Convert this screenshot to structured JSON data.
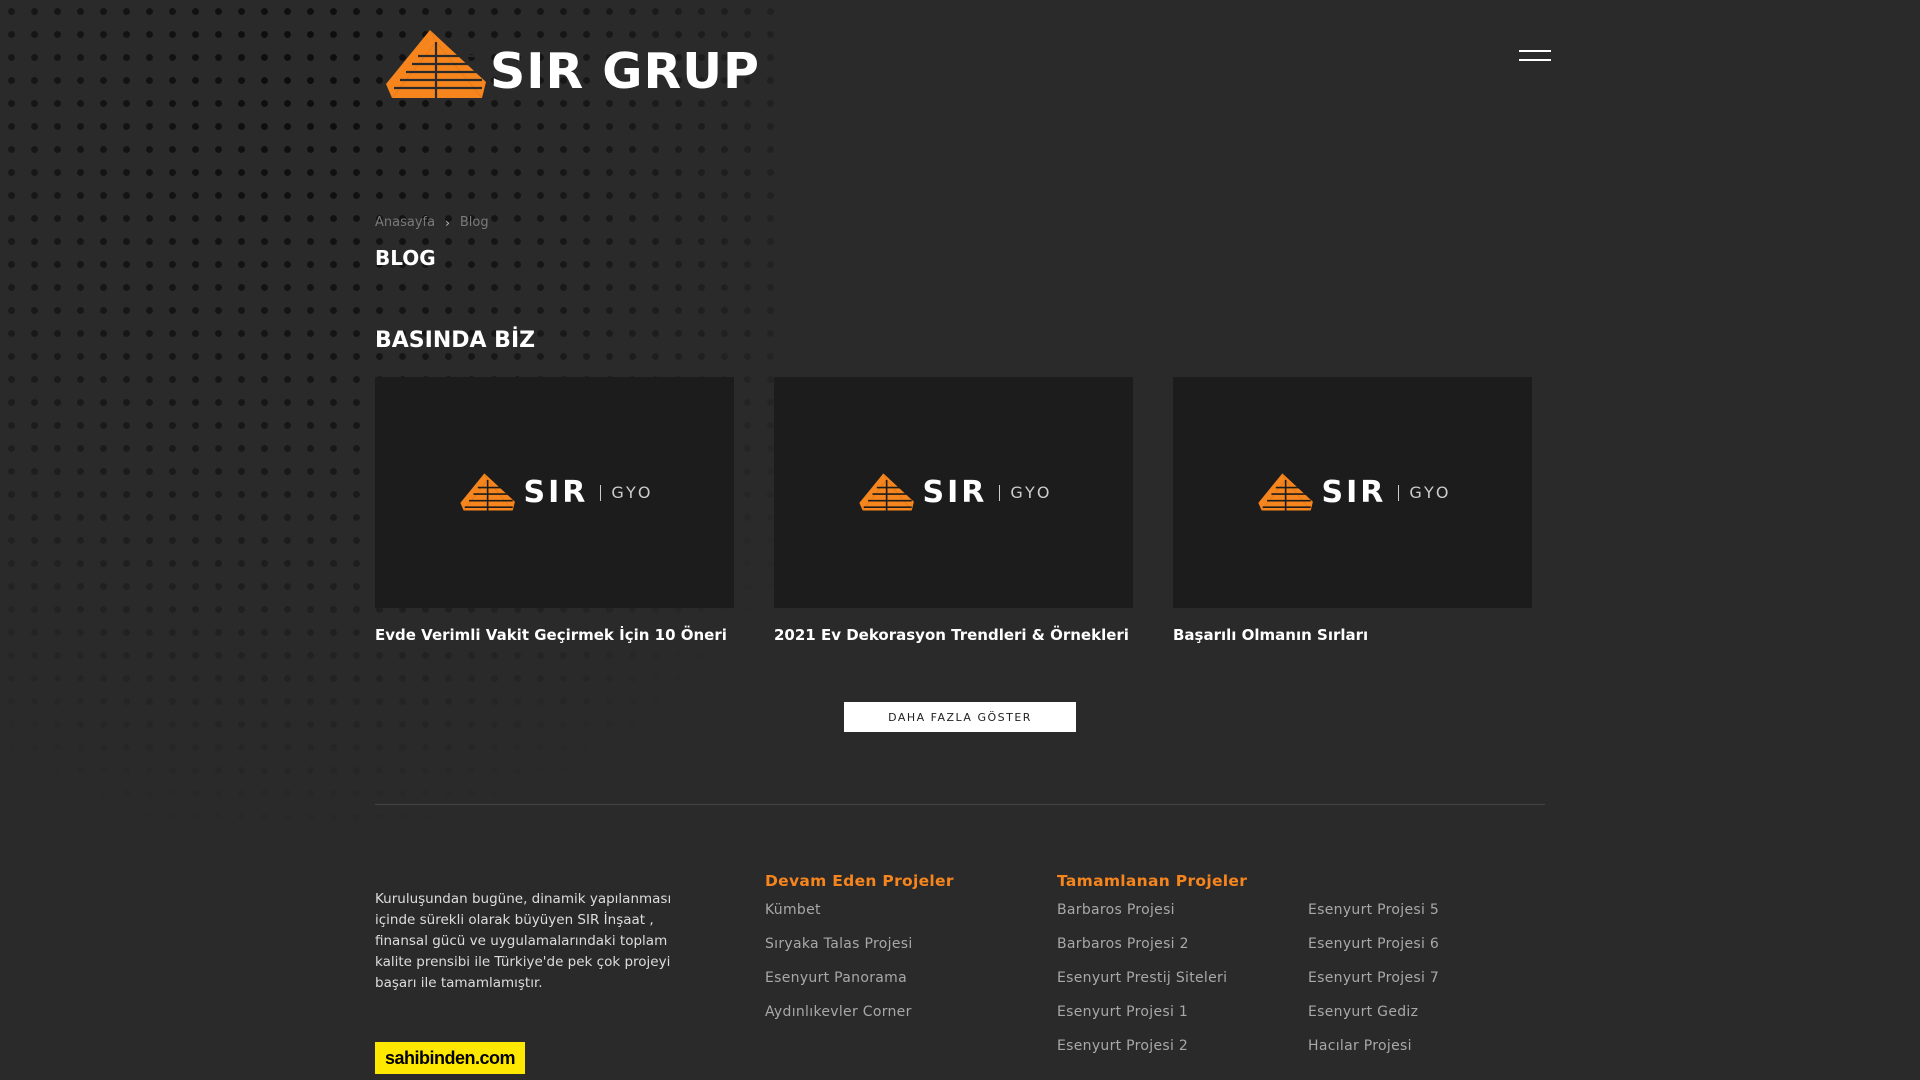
{
  "header": {
    "logo_text": "SIR GRUP",
    "brand_color": "#f7851d"
  },
  "breadcrumb": {
    "home": "Anasayfa",
    "separator": "›",
    "current": "Blog"
  },
  "page_title": "BLOG",
  "section_title": "BASINDA BİZ",
  "cards": [
    {
      "logo_name": "SIR",
      "logo_suffix": "GYO",
      "title": "Evde Verimli Vakit Geçirmek İçin 10 Öneri"
    },
    {
      "logo_name": "SIR",
      "logo_suffix": "GYO",
      "title": "2021 Ev Dekorasyon Trendleri & Örnekleri"
    },
    {
      "logo_name": "SIR",
      "logo_suffix": "GYO",
      "title": "Başarılı Olmanın Sırları"
    }
  ],
  "more_button": "DAHA FAZLA GÖSTER",
  "footer": {
    "about": "Kuruluşundan bugüne, dinamik yapılanması içinde sürekli olarak büyüyen SIR İnşaat , finansal gücü ve uygulamalarındaki toplam kalite prensibi ile Türkiye'de pek çok projeyi başarı ile tamamlamıştır.",
    "sahibinden": "sahibinden.com",
    "ongoing": {
      "title": "Devam Eden Projeler",
      "items": [
        "Kümbet",
        "Sıryaka Talas Projesi",
        "Esenyurt Panorama",
        "Aydınlıkevler Corner"
      ]
    },
    "completed": {
      "title": "Tamamlanan Projeler",
      "items": [
        "Barbaros Projesi",
        "Barbaros Projesi 2",
        "Esenyurt Prestij Siteleri",
        "Esenyurt Projesi 1",
        "Esenyurt Projesi 2"
      ]
    },
    "completed_more": {
      "items": [
        "Esenyurt Projesi 5",
        "Esenyurt Projesi 6",
        "Esenyurt Projesi 7",
        "Esenyurt Gediz",
        "Hacılar Projesi"
      ]
    }
  }
}
